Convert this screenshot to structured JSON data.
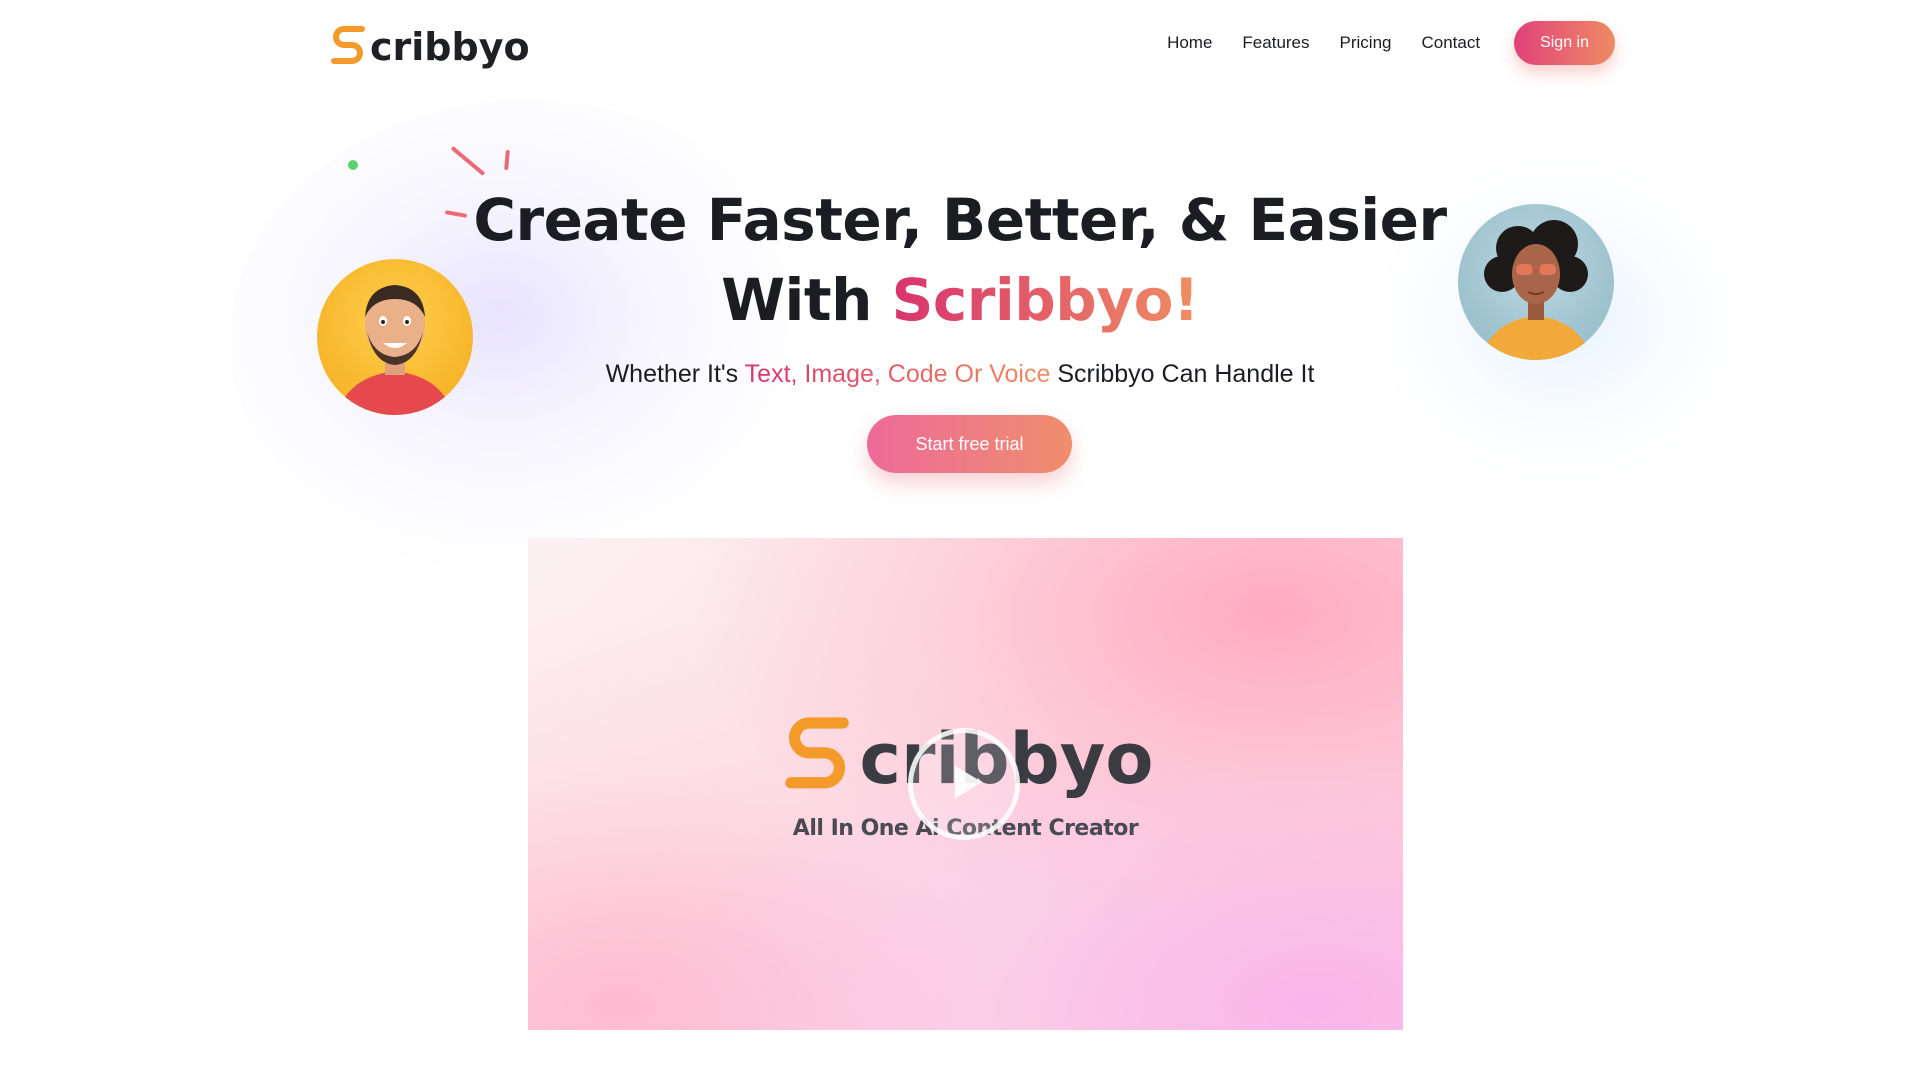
{
  "header": {
    "logo_text": "cribbyo",
    "nav": [
      {
        "label": "Home"
      },
      {
        "label": "Features"
      },
      {
        "label": "Pricing"
      },
      {
        "label": "Contact"
      }
    ],
    "signin_label": "Sign in"
  },
  "hero": {
    "title_line1": "Create Faster, Better, & Easier",
    "title_line2_prefix": "With ",
    "title_brand": "Scribbyo!",
    "subtitle_prefix": "Whether It's ",
    "subtitle_highlight": "Text, Image, Code Or Voice",
    "subtitle_suffix": " Scribbyo Can Handle It",
    "cta_label": "Start free trial"
  },
  "video": {
    "logo_text": "cribbyo",
    "tagline": "All In One Ai Content Creator"
  },
  "colors": {
    "brand_pink": "#d8336f",
    "brand_orange": "#ef8e62",
    "logo_orange": "#f39a2b",
    "text_dark": "#1c1d22",
    "accent_green": "#5bd16b"
  },
  "icons": {
    "logo": "scribbyo-s-logo-icon",
    "play": "play-icon"
  }
}
